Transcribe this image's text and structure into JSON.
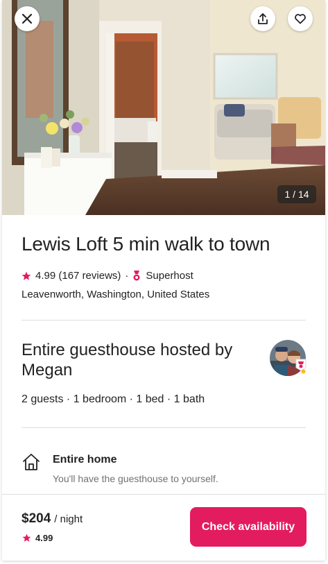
{
  "photo": {
    "counter": "1 / 14"
  },
  "listing": {
    "title": "Lewis Loft 5 min walk to town",
    "rating": "4.99",
    "reviews": "(167 reviews)",
    "separator": "·",
    "superhost": "Superhost",
    "location": "Leavenworth, Washington, United States"
  },
  "host": {
    "title": "Entire guesthouse hosted by Megan",
    "specs": "2 guests · 1 bedroom · 1 bed · 1 bath"
  },
  "feature": {
    "icon": "home-icon",
    "title": "Entire home",
    "description": "You'll have the guesthouse to yourself."
  },
  "footer": {
    "price": "$204",
    "per": "/ night",
    "rating": "4.99",
    "cta": "Check availability"
  },
  "colors": {
    "brand": "#e31c5f",
    "star": "#e31c5f",
    "text": "#222222",
    "muted": "#717171",
    "divider": "#dddddd"
  }
}
